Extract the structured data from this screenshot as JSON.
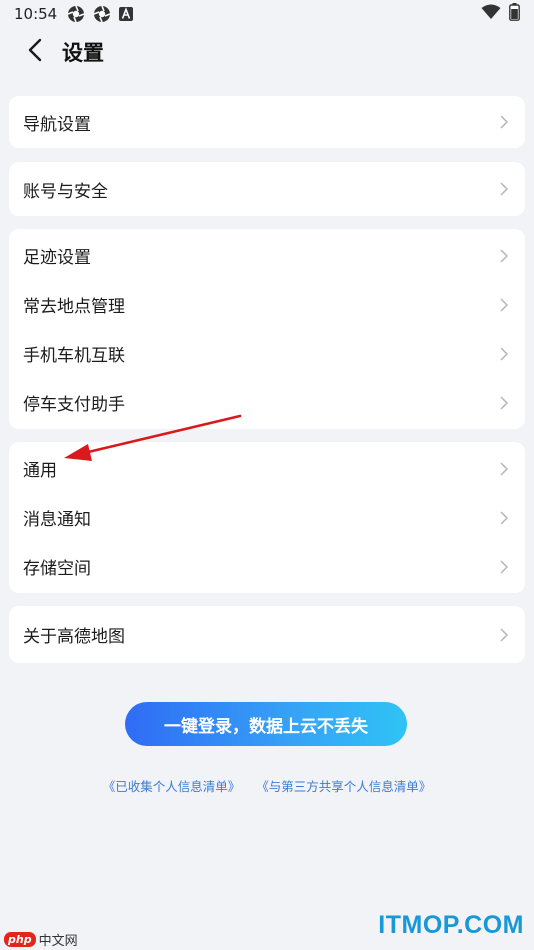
{
  "status_bar": {
    "time": "10:54",
    "icons": [
      "aperture-icon",
      "aperture-icon",
      "font-a-icon"
    ],
    "right_icons": [
      "wifi-icon",
      "battery-icon"
    ]
  },
  "header": {
    "back_icon": "chevron-left-icon",
    "title": "设置"
  },
  "groups": [
    {
      "items": [
        {
          "label": "导航设置"
        }
      ]
    },
    {
      "items": [
        {
          "label": "账号与安全"
        }
      ]
    },
    {
      "items": [
        {
          "label": "足迹设置"
        },
        {
          "label": "常去地点管理"
        },
        {
          "label": "手机车机互联"
        },
        {
          "label": "停车支付助手"
        }
      ]
    },
    {
      "items": [
        {
          "label": "通用"
        },
        {
          "label": "消息通知"
        },
        {
          "label": "存储空间"
        }
      ]
    },
    {
      "items": [
        {
          "label": "关于高德地图"
        }
      ]
    }
  ],
  "login_button": {
    "label": "一键登录，数据上云不丢失"
  },
  "links": {
    "collected_info": "《已收集个人信息清单》",
    "third_party_info": "《与第三方共享个人信息清单》"
  },
  "watermarks": {
    "left_badge": "php",
    "left_text": "中文网",
    "right_text": "ITMOP.COM"
  },
  "colors": {
    "background": "#f2f3f7",
    "card": "#ffffff",
    "link": "#3b7bd6",
    "button_gradient_start": "#2f6cf5",
    "button_gradient_end": "#2fc3f5",
    "annotation_arrow": "#d9191c"
  }
}
